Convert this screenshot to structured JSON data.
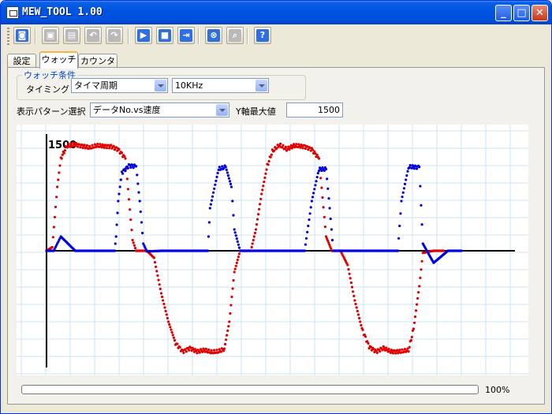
{
  "window": {
    "title": "MEW_TOOL 1.00"
  },
  "toolbar": {
    "buttons": [
      {
        "name": "camera-icon",
        "glyph": "◙",
        "enabled": true
      },
      {
        "name": "copy-icon",
        "glyph": "▣",
        "enabled": false
      },
      {
        "name": "paste-icon",
        "glyph": "▤",
        "enabled": false
      },
      {
        "name": "undo-icon",
        "glyph": "↶",
        "enabled": false
      },
      {
        "name": "redo-icon",
        "glyph": "↷",
        "enabled": false
      },
      {
        "name": "play-icon",
        "glyph": "▶",
        "enabled": true
      },
      {
        "name": "stop-icon",
        "glyph": "■",
        "enabled": true
      },
      {
        "name": "export-icon",
        "glyph": "⇥",
        "enabled": true
      },
      {
        "name": "cancel-icon",
        "glyph": "⊗",
        "enabled": true
      },
      {
        "name": "search-icon",
        "glyph": "⌕",
        "enabled": false
      },
      {
        "name": "help-icon",
        "glyph": "?",
        "enabled": true
      }
    ]
  },
  "tabs": [
    {
      "label": "設定",
      "active": false
    },
    {
      "label": "ウォッチ",
      "active": true
    },
    {
      "label": "カウンタ",
      "active": false
    }
  ],
  "watch": {
    "group_title": "ウォッチ条件",
    "timing_label": "タイミング",
    "timing_value": "タイマ周期",
    "frequency_value": "10KHz"
  },
  "display": {
    "pattern_label": "表示パターン選択",
    "pattern_value": "データNo.vs速度",
    "ymax_label": "Y軸最大値",
    "ymax_value": "1500"
  },
  "chart_data": {
    "type": "scatter",
    "y_max_label": "1500",
    "ylim": [
      -1500,
      1500
    ],
    "xlim": [
      0,
      660
    ],
    "grid": true,
    "series": [
      {
        "color": "#e00000",
        "points": [
          [
            0,
            0
          ],
          [
            8,
            50
          ],
          [
            15,
            900
          ],
          [
            20,
            1300
          ],
          [
            28,
            1470
          ],
          [
            40,
            1500
          ],
          [
            60,
            1450
          ],
          [
            70,
            1480
          ],
          [
            90,
            1470
          ],
          [
            100,
            1430
          ],
          [
            110,
            1300
          ],
          [
            120,
            150
          ],
          [
            125,
            0
          ],
          [
            140,
            0
          ],
          [
            150,
            -100
          ],
          [
            160,
            -600
          ],
          [
            170,
            -1000
          ],
          [
            180,
            -1300
          ],
          [
            190,
            -1420
          ],
          [
            200,
            -1370
          ],
          [
            210,
            -1420
          ],
          [
            220,
            -1400
          ],
          [
            230,
            -1430
          ],
          [
            240,
            -1420
          ],
          [
            248,
            -1380
          ],
          [
            255,
            -1000
          ],
          [
            262,
            -300
          ],
          [
            270,
            0
          ],
          [
            285,
            0
          ],
          [
            292,
            300
          ],
          [
            300,
            800
          ],
          [
            308,
            1200
          ],
          [
            315,
            1400
          ],
          [
            325,
            1490
          ],
          [
            335,
            1430
          ],
          [
            345,
            1480
          ],
          [
            360,
            1470
          ],
          [
            370,
            1430
          ],
          [
            380,
            1300
          ],
          [
            390,
            200
          ],
          [
            398,
            0
          ],
          [
            410,
            0
          ],
          [
            420,
            -200
          ],
          [
            430,
            -700
          ],
          [
            440,
            -1100
          ],
          [
            450,
            -1350
          ],
          [
            460,
            -1420
          ],
          [
            470,
            -1370
          ],
          [
            480,
            -1420
          ],
          [
            495,
            -1420
          ],
          [
            505,
            -1400
          ],
          [
            512,
            -1100
          ],
          [
            520,
            -500
          ],
          [
            525,
            -30
          ],
          [
            540,
            0
          ],
          [
            555,
            0
          ]
        ]
      },
      {
        "color": "#0000e0",
        "points": [
          [
            0,
            0
          ],
          [
            10,
            0
          ],
          [
            20,
            200
          ],
          [
            40,
            0
          ],
          [
            60,
            0
          ],
          [
            80,
            0
          ],
          [
            95,
            0
          ],
          [
            97,
            200
          ],
          [
            100,
            700
          ],
          [
            105,
            1100
          ],
          [
            115,
            1200
          ],
          [
            125,
            1190
          ],
          [
            130,
            700
          ],
          [
            135,
            100
          ],
          [
            140,
            -10
          ],
          [
            160,
            0
          ],
          [
            190,
            0
          ],
          [
            210,
            0
          ],
          [
            225,
            0
          ],
          [
            228,
            600
          ],
          [
            240,
            1150
          ],
          [
            250,
            1180
          ],
          [
            258,
            900
          ],
          [
            262,
            300
          ],
          [
            270,
            0
          ],
          [
            300,
            0
          ],
          [
            340,
            0
          ],
          [
            360,
            0
          ],
          [
            370,
            700
          ],
          [
            380,
            1150
          ],
          [
            390,
            1150
          ],
          [
            395,
            600
          ],
          [
            400,
            0
          ],
          [
            430,
            0
          ],
          [
            460,
            0
          ],
          [
            480,
            0
          ],
          [
            490,
            0
          ],
          [
            495,
            700
          ],
          [
            505,
            1180
          ],
          [
            520,
            1180
          ],
          [
            525,
            100
          ],
          [
            540,
            -170
          ],
          [
            560,
            0
          ],
          [
            580,
            0
          ]
        ]
      }
    ]
  },
  "progress": {
    "value": 100,
    "label": "100%"
  }
}
